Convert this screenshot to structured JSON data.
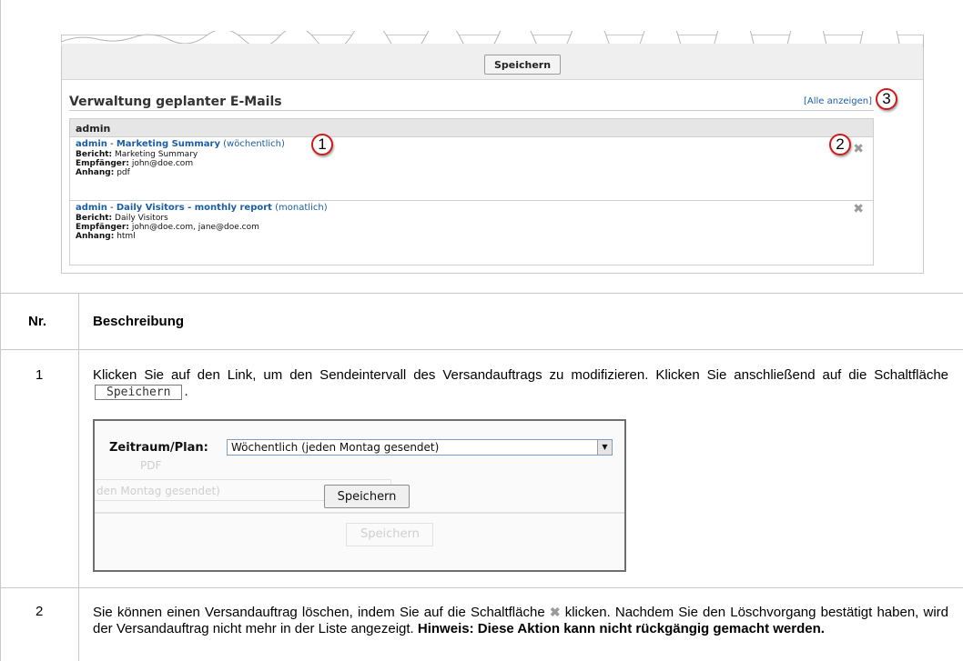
{
  "screenshot": {
    "save_button": "Speichern",
    "section_title": "Verwaltung geplanter E-Mails",
    "show_all_link": "[Alle anzeigen]",
    "group_header": "admin",
    "reports": [
      {
        "user": "admin",
        "sep": " - ",
        "name": "Marketing Summary",
        "interval": "(wöchentlich)",
        "report_label": "Bericht:",
        "report_value": "Marketing Summary",
        "recipient_label": "Empfänger:",
        "recipient_value": "john@doe.com",
        "attachment_label": "Anhang:",
        "attachment_value": "pdf",
        "delete_icon": "x-icon"
      },
      {
        "user": "admin",
        "sep": " - ",
        "name": "Daily Visitors - monthly report",
        "interval": "(monatlich)",
        "report_label": "Bericht:",
        "report_value": "Daily Visitors",
        "recipient_label": "Empfänger:",
        "recipient_value": "john@doe.com, jane@doe.com",
        "attachment_label": "Anhang:",
        "attachment_value": "html",
        "delete_icon": "x-icon"
      }
    ],
    "callouts": [
      "1",
      "2",
      "3"
    ]
  },
  "table": {
    "col_nr": "Nr.",
    "col_desc": "Beschreibung",
    "rows": [
      {
        "nr": "1",
        "text_before": "Klicken Sie auf den Link, um den Sendeintervall des Versandauftrags zu modifizieren. Klicken Sie anschließend auf die Schaltfläche",
        "button": "Speichern",
        "text_after": "."
      },
      {
        "nr": "2",
        "text_before": "Sie können einen Versandauftrag löschen, indem Sie auf die Schaltfläche",
        "icon": "x-icon",
        "text_after": "klicken. Nachdem Sie den Löschvorgang bestätigt haben, wird der Versandauftrag nicht mehr in der Liste angezeigt.",
        "note": "Hinweis: Diese Aktion kann nicht rückgängig gemacht werden."
      }
    ]
  },
  "inner_screenshot": {
    "label": "Zeitraum/Plan:",
    "selected": "Wöchentlich (jeden Montag gesendet)",
    "save_button": "Speichern",
    "ghost_text_1": "PDF",
    "ghost_text_2": "den Montag gesendet)",
    "ghost_button": "Speichern"
  }
}
